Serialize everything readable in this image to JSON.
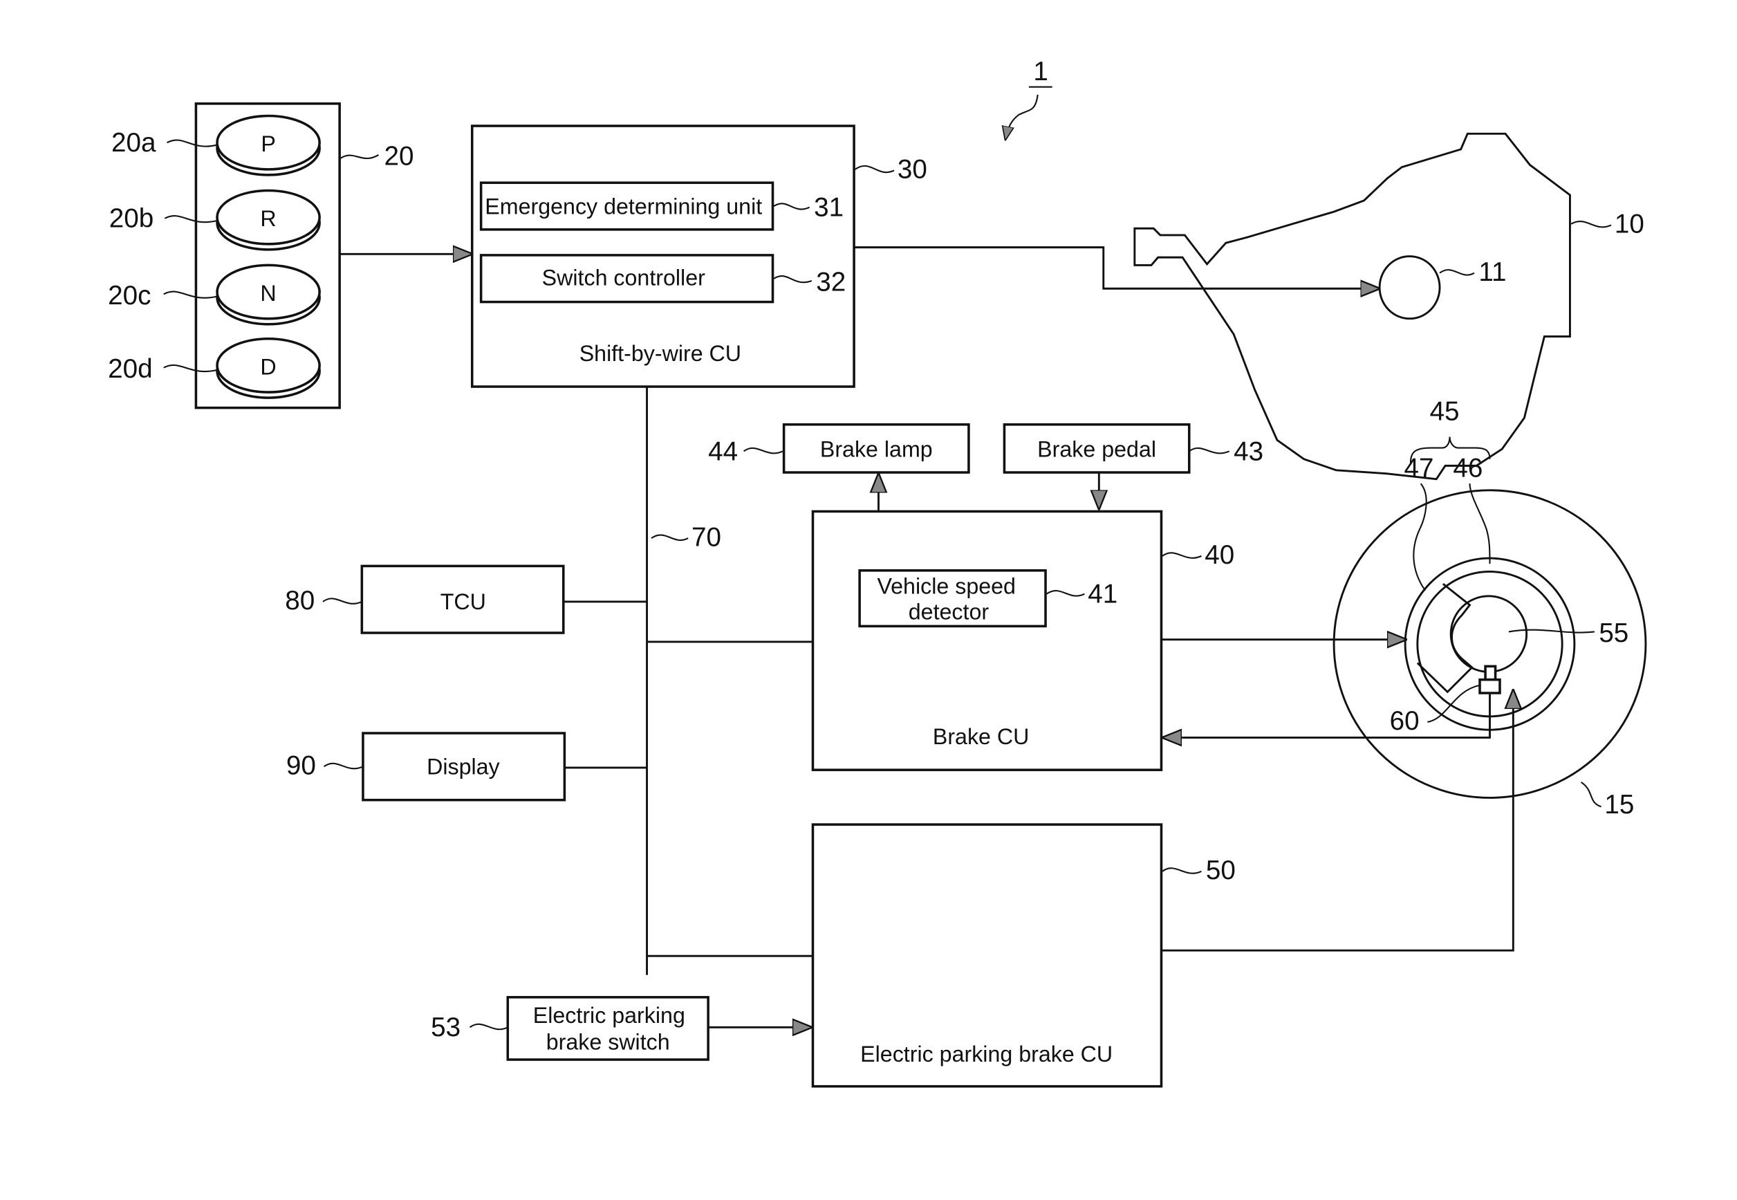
{
  "figure": {
    "ref_system": "1",
    "selector": {
      "ref": "20",
      "buttons": [
        {
          "ref": "20a",
          "label": "P"
        },
        {
          "ref": "20b",
          "label": "R"
        },
        {
          "ref": "20c",
          "label": "N"
        },
        {
          "ref": "20d",
          "label": "D"
        }
      ]
    },
    "shift_cu": {
      "ref": "30",
      "label": "Shift-by-wire CU",
      "emergency": {
        "ref": "31",
        "label": "Emergency determining unit"
      },
      "switch_ctrl": {
        "ref": "32",
        "label": "Switch controller"
      }
    },
    "transmission": {
      "ref": "10",
      "actuator_ref": "11"
    },
    "bus": {
      "ref": "70"
    },
    "tcu": {
      "ref": "80",
      "label": "TCU"
    },
    "display": {
      "ref": "90",
      "label": "Display"
    },
    "brake_lamp": {
      "ref": "44",
      "label": "Brake lamp"
    },
    "brake_pedal": {
      "ref": "43",
      "label": "Brake pedal"
    },
    "brake_cu": {
      "ref": "40",
      "label": "Brake CU",
      "speed_detector": {
        "ref": "41",
        "label_line1": "Vehicle speed",
        "label_line2": "detector"
      }
    },
    "epb_cu": {
      "ref": "50",
      "label": "Electric parking brake CU"
    },
    "epb_switch": {
      "ref": "53",
      "label_line1": "Electric parking",
      "label_line2": "brake switch"
    },
    "wheel": {
      "ref": "15",
      "brake_ref": "45",
      "disc_ref": "46",
      "caliper_ref": "47",
      "hub_ref": "55",
      "sensor_ref": "60"
    }
  }
}
